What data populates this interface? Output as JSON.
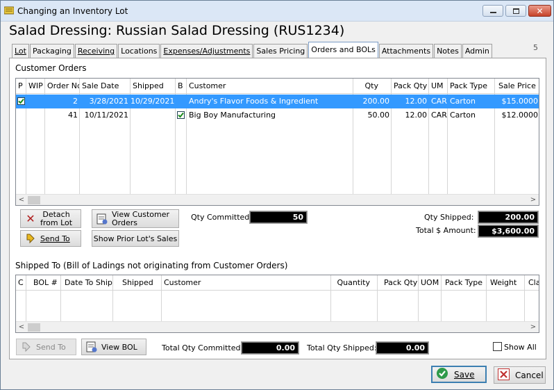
{
  "window": {
    "title": "Changing an Inventory Lot",
    "minimize": "—",
    "maximize": "□",
    "close": "✕"
  },
  "heading": "Salad Dressing: Russian Salad Dressing (RUS1234)",
  "page_number": "5",
  "tabs": [
    "Lot",
    "Packaging",
    "Receiving",
    "Locations",
    "Expenses/Adjustments",
    "Sales Pricing",
    "Orders and BOLs",
    "Attachments",
    "Notes",
    "Admin"
  ],
  "active_tab": "Orders and BOLs",
  "customer_orders": {
    "title": "Customer Orders",
    "columns": [
      "P",
      "WIP",
      "Order Nc",
      "Sale Date",
      "Shipped",
      "B",
      "Customer",
      "Qty",
      "Pack Qty",
      "UM",
      "Pack Type",
      "Sale Price"
    ],
    "rows": [
      {
        "p": "check",
        "wip": "",
        "order": "2",
        "sale_date": "3/28/2021",
        "shipped": "10/29/2021",
        "b": "",
        "customer": "Andry's Flavor Foods & Ingredient",
        "qty": "200.00",
        "pack_qty": "12.00",
        "um": "CAR",
        "pack_type": "Carton",
        "sale_price": "$15.0000",
        "selected": true
      },
      {
        "p": "",
        "wip": "",
        "order": "41",
        "sale_date": "10/11/2021",
        "shipped": "",
        "b": "check",
        "customer": "Big Boy Manufacturing",
        "qty": "50.00",
        "pack_qty": "12.00",
        "um": "CAR",
        "pack_type": "Carton",
        "sale_price": "$12.0000",
        "selected": false
      }
    ],
    "buttons": {
      "detach_line1": "Detach",
      "detach_line2": "from Lot",
      "view_customer_orders_line1": "View Customer",
      "view_customer_orders_line2": "Orders",
      "send_to": "Send To",
      "show_prior": "Show Prior Lot's Sales"
    },
    "qty_committed_label": "Qty Committed:",
    "qty_committed": "50",
    "qty_shipped_label": "Qty Shipped:",
    "qty_shipped": "200.00",
    "total_amount_label": "Total $ Amount:",
    "total_amount": "$3,600.00"
  },
  "shipped_to": {
    "title": "Shipped To (Bill of Ladings not originating from Customer Orders)",
    "columns": [
      "C",
      "BOL #",
      "Date To Ship",
      "Shipped",
      "Customer",
      "Quantity",
      "Pack Qty",
      "UOM",
      "Pack Type",
      "Weight",
      "Cla"
    ],
    "buttons": {
      "send_to": "Send To",
      "view_bol": "View BOL"
    },
    "total_committed_label": "Total Qty Committed:",
    "total_committed": "0.00",
    "total_shipped_label": "Total Qty Shipped:",
    "total_shipped": "0.00",
    "show_all_label": "Show All"
  },
  "footer": {
    "save": "Save",
    "cancel": "Cancel"
  }
}
